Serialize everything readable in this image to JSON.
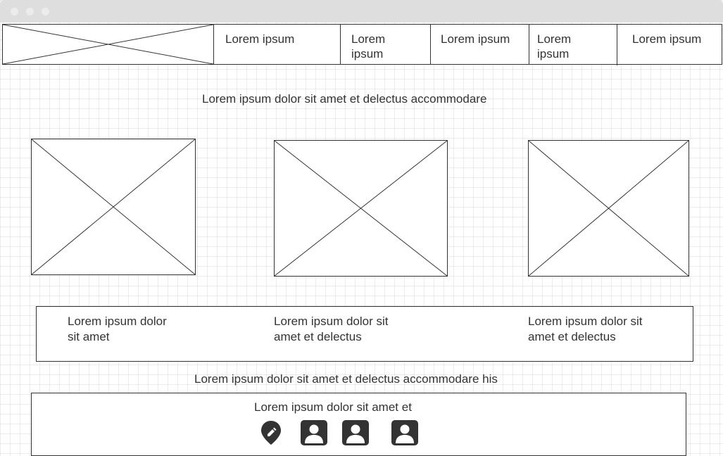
{
  "nav": {
    "items": [
      {
        "label": "Lorem ipsum"
      },
      {
        "label": "Lorem ipsum"
      },
      {
        "label": "Lorem ipsum"
      },
      {
        "label": "Lorem ipsum"
      },
      {
        "label": "Lorem ipsum"
      }
    ]
  },
  "hero": {
    "heading": "Lorem ipsum dolor sit amet et delectus accommodare"
  },
  "features": {
    "captions": [
      "Lorem ipsum dolor sit amet",
      "Lorem ipsum dolor sit amet et delectus",
      "Lorem ipsum dolor sit amet et delectus"
    ]
  },
  "section": {
    "heading": "Lorem ipsum dolor sit amet et delectus accommodare his"
  },
  "footer": {
    "text": "Lorem ipsum dolor sit amet et",
    "icons": [
      "map-pin-icon",
      "contact-icon",
      "contact-icon",
      "contact-icon"
    ]
  }
}
